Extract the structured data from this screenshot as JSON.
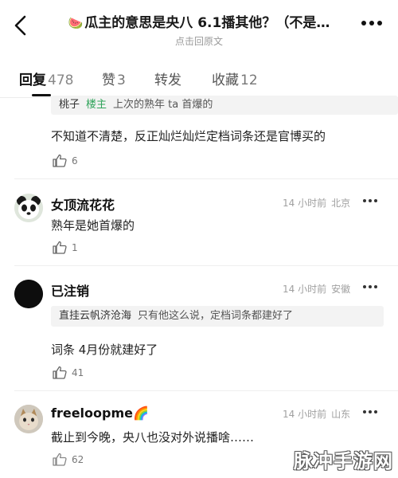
{
  "header": {
    "title_emoji": "🍉",
    "title": "瓜主的意思是央八 6.1播其他？（不是…",
    "subtitle": "点击回原文"
  },
  "tabs": [
    {
      "label": "回复",
      "count": "478"
    },
    {
      "label": "赞",
      "count": "3"
    },
    {
      "label": "转发",
      "count": ""
    },
    {
      "label": "收藏",
      "count": "12"
    }
  ],
  "comments": [
    {
      "quote": {
        "user": "桃子",
        "badge": "楼主",
        "text": "上次的熟年 ta 首爆的"
      },
      "text": "不知道不清楚，反正灿烂灿烂定档词条还是官博买的",
      "likes": "6"
    },
    {
      "username": "女顶流花花",
      "time": "14 小时前",
      "location": "北京",
      "avatar": "panda-avatar",
      "text": "熟年是她首爆的",
      "likes": "1"
    },
    {
      "username": "已注销",
      "time": "14 小时前",
      "location": "安徽",
      "avatar": "black-avatar",
      "quote": {
        "user": "直挂云帆济沧海",
        "text": "只有他这么说，定档词条都建好了"
      },
      "text": "词条 4月份就建好了",
      "likes": "41"
    },
    {
      "username": "freeloopme",
      "username_emoji": "🌈",
      "time": "14 小时前",
      "location": "山东",
      "avatar": "cat-avatar",
      "text": "截止到今晚，央八也没对外说播啥……",
      "likes": "62"
    }
  ],
  "watermark": "脉冲手游网",
  "colors": {
    "badge_green": "#2fa35a",
    "meta_gray": "#a0a0a0",
    "quote_bg": "#f3f3f3"
  }
}
